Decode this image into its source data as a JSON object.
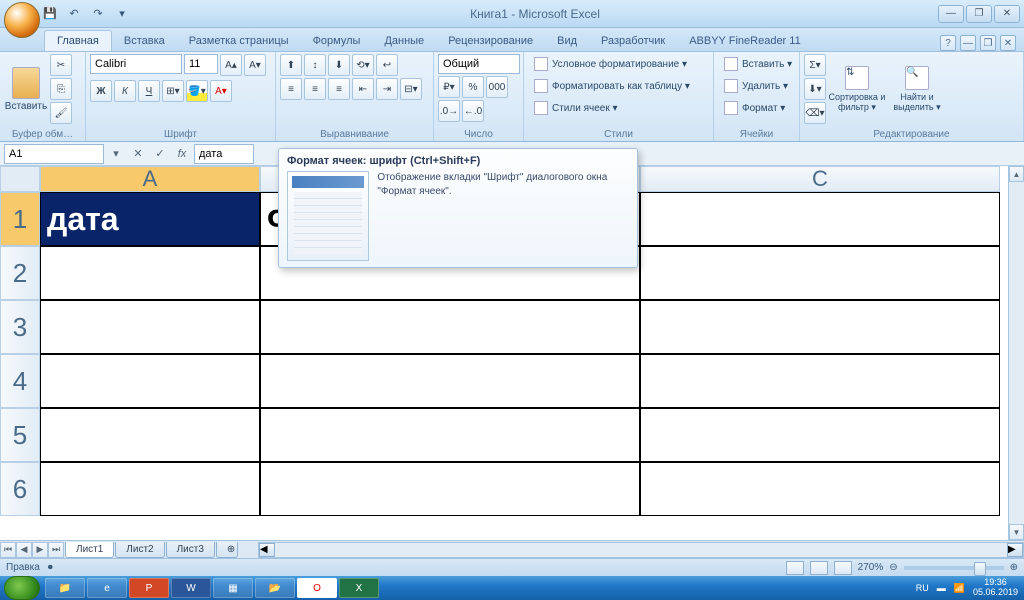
{
  "app": {
    "title": "Книга1 - Microsoft Excel"
  },
  "qat": {
    "save": "💾",
    "undo": "↶",
    "redo": "↷"
  },
  "tabs": {
    "home": "Главная",
    "insert": "Вставка",
    "layout": "Разметка страницы",
    "formulas": "Формулы",
    "data": "Данные",
    "review": "Рецензирование",
    "view": "Вид",
    "developer": "Разработчик",
    "abbyy": "ABBYY FineReader 11"
  },
  "ribbon": {
    "clipboard": {
      "paste": "Вставить",
      "label": "Буфер обм…"
    },
    "font": {
      "name": "Calibri",
      "size": "11",
      "label": "Шрифт",
      "bold": "Ж",
      "italic": "К",
      "underline": "Ч"
    },
    "alignment": {
      "label": "Выравнивание"
    },
    "number": {
      "format": "Общий",
      "label": "Число"
    },
    "styles": {
      "cond_format": "Условное форматирование ▾",
      "as_table": "Форматировать как таблицу ▾",
      "cell_styles": "Стили ячеек ▾",
      "label": "Стили"
    },
    "cells": {
      "insert": "Вставить ▾",
      "delete": "Удалить ▾",
      "format": "Формат ▾",
      "label": "Ячейки"
    },
    "editing": {
      "sort": "Сортировка и фильтр ▾",
      "find": "Найти и выделить ▾",
      "label": "Редактирование"
    }
  },
  "formula_bar": {
    "cell_ref": "A1",
    "formula": "дата"
  },
  "tooltip": {
    "title": "Формат ячеек: шрифт (Ctrl+Shift+F)",
    "desc": "Отображение вкладки \"Шрифт\" диалогового окна \"Формат ячеек\"."
  },
  "grid": {
    "cols": [
      "A",
      "",
      "C"
    ],
    "rows": [
      "1",
      "2",
      "3",
      "4",
      "5",
      "6"
    ],
    "a1": "дата",
    "b1": "ФИ"
  },
  "sheets": {
    "s1": "Лист1",
    "s2": "Лист2",
    "s3": "Лист3"
  },
  "status": {
    "mode": "Правка",
    "zoom": "270%",
    "lang": "RU",
    "time": "19:36",
    "date": "05.06.2019"
  }
}
